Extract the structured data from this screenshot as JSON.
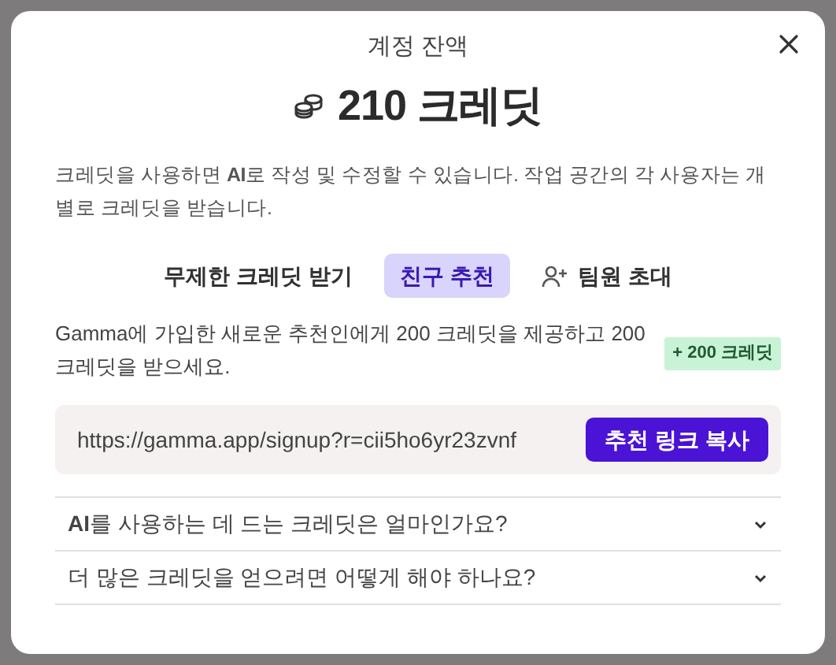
{
  "dialog": {
    "title": "계정 잔액",
    "balance": "210 크레딧",
    "description": "크레딧을 사용하면 **AI**로 작성 및 수정할 수 있습니다. 작업 공간의 각 사용자는 개별로 크레딧을 받습니다."
  },
  "tabs": [
    {
      "label": "무제한 크레딧 받기",
      "selected": false,
      "kind": "plain"
    },
    {
      "label": "친구 추천",
      "selected": true,
      "kind": "plain"
    },
    {
      "label": "팀원 초대",
      "selected": false,
      "kind": "invite"
    }
  ],
  "referral": {
    "text": "Gamma에 가입한 새로운 추천인에게 200 크레딧을 제공하고 200 크레딧을 받으세요.",
    "badge": "+ 200 크레딧",
    "link": "https://gamma.app/signup?r=cii5ho6yr23zvnf",
    "copy_button": "추천 링크 복사"
  },
  "faq": [
    {
      "question": "**AI**를 사용하는 데 드는 크레딧은 얼마인가요?",
      "expanded": false
    },
    {
      "question": "더 많은 크레딧을 얻으려면 어떻게 해야 하나요?",
      "expanded": false
    }
  ]
}
